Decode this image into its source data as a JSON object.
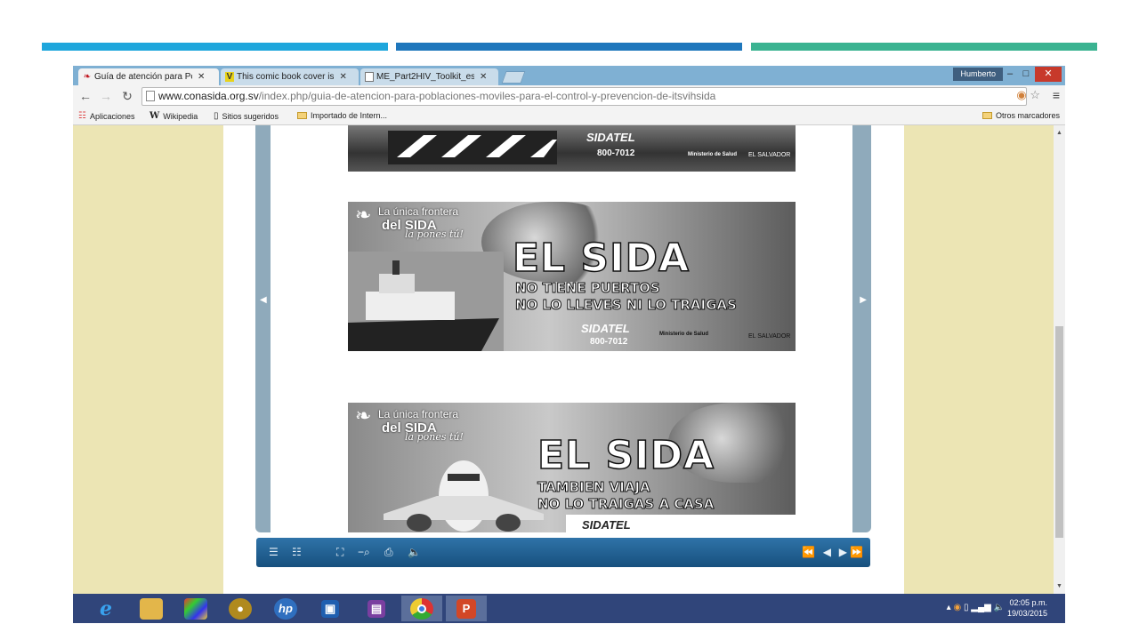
{
  "browser": {
    "tabs": [
      {
        "label": "Guía de atención para Pol",
        "icon": "aids-ribbon-icon",
        "active": true
      },
      {
        "label": "This comic book cover is",
        "icon": "v-logo-icon",
        "active": false
      },
      {
        "label": "ME_Part2HIV_Toolkit_es.p",
        "icon": "document-icon",
        "active": false
      }
    ],
    "user": "Humberto",
    "address": {
      "domain": "www.conasida.org.sv",
      "path": "/index.php/guia-de-atencion-para-poblaciones-moviles-para-el-control-y-prevencion-de-itsvihsida"
    },
    "bookmarks": [
      {
        "label": "Aplicaciones",
        "icon": "apps-grid-icon"
      },
      {
        "label": "Wikipedia",
        "icon": "wikipedia-icon"
      },
      {
        "label": "Sitios sugeridos",
        "icon": "page-icon"
      },
      {
        "label": "Importado de Intern...",
        "icon": "folder-icon"
      }
    ],
    "other_bookmarks": "Otros marcadores"
  },
  "banners": {
    "hotline_brand": "SIDATEL",
    "hotline_number": "800-7012",
    "ministry": "Ministerio de Salud",
    "country": "EL SALVADOR",
    "slogan_top": "La única frontera",
    "slogan_mid": "del SIDA",
    "slogan_bottom": "la pones tú!",
    "headline": "EL SIDA",
    "ports_line1": "NO TIENE PUERTOS",
    "ports_line2": "NO LO LLEVES NI LO TRAIGAS",
    "travel_line1": "TAMBIEN VIAJA",
    "travel_line2": "NO LO TRAIGAS A CASA"
  },
  "taskbar": {
    "apps": [
      {
        "name": "internet-explorer",
        "active": false,
        "color": "#1f7fd0"
      },
      {
        "name": "file-explorer",
        "active": false,
        "color": "#e3b64a"
      },
      {
        "name": "photo-app",
        "active": false,
        "color": "#553f7a"
      },
      {
        "name": "media-player",
        "active": false,
        "color": "#b08a1e"
      },
      {
        "name": "hp-support",
        "active": false,
        "color": "#2f6fbf"
      },
      {
        "name": "remote-desktop",
        "active": false,
        "color": "#1f5fb0"
      },
      {
        "name": "onenote",
        "active": false,
        "color": "#7a3fa0"
      },
      {
        "name": "chrome",
        "active": true,
        "color": "#3b8a3b"
      },
      {
        "name": "powerpoint",
        "active": true,
        "color": "#d24726"
      }
    ],
    "time": "02:05 p.m.",
    "date": "19/03/2015"
  },
  "colors": {
    "deco1": "#1ea6dc",
    "deco2": "#1f77bc",
    "deco3": "#3bb391",
    "page_bg": "#ece5b4",
    "player": "#17507e"
  }
}
